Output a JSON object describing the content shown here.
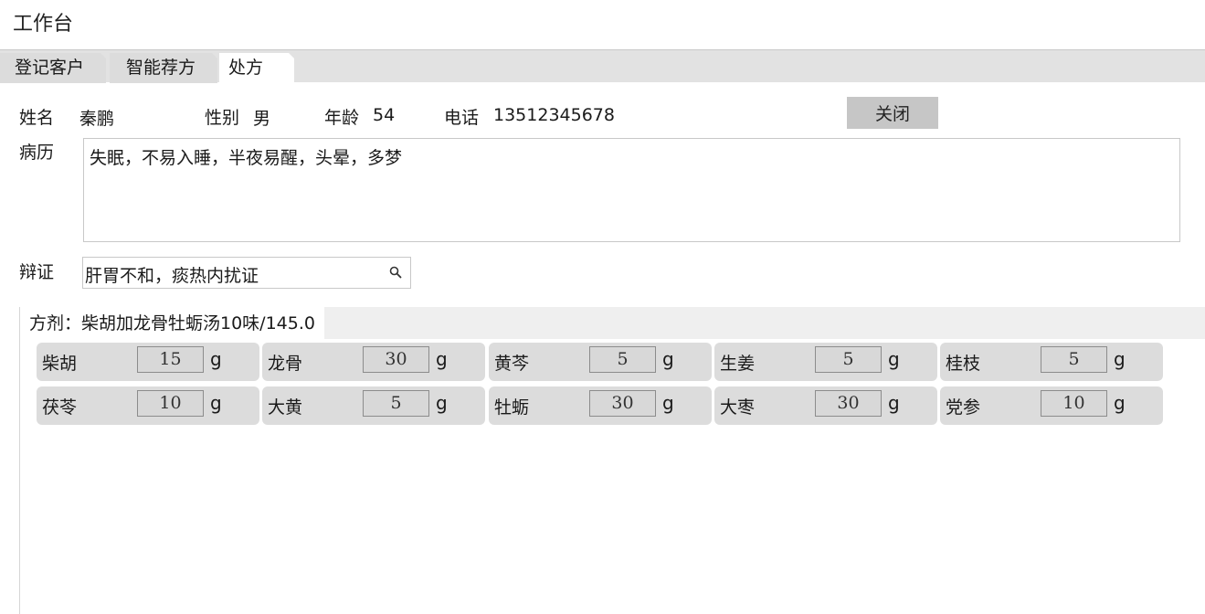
{
  "app": {
    "title": "工作台"
  },
  "tabs": [
    {
      "label": "登记客户",
      "active": false
    },
    {
      "label": "智能荐方",
      "active": false
    },
    {
      "label": "处方",
      "active": true
    }
  ],
  "patient": {
    "name_label": "姓名",
    "name": "秦鹏",
    "gender_label": "性别",
    "gender": "男",
    "age_label": "年龄",
    "age": "54",
    "phone_label": "电话",
    "phone": "13512345678"
  },
  "close_button": "关闭",
  "history": {
    "label": "病历",
    "value": "失眠，不易入睡，半夜易醒，头晕，多梦"
  },
  "diagnosis": {
    "label": "辩证",
    "value": "肝胃不和，痰热内扰证",
    "icon": "search-icon"
  },
  "formula": {
    "title": "方剂：柴胡加龙骨牡蛎汤10味/145.0",
    "unit": "g",
    "herbs": [
      {
        "name": "柴胡",
        "dose": "15"
      },
      {
        "name": "龙骨",
        "dose": "30"
      },
      {
        "name": "黄芩",
        "dose": "5"
      },
      {
        "name": "生姜",
        "dose": "5"
      },
      {
        "name": "桂枝",
        "dose": "5"
      },
      {
        "name": "茯苓",
        "dose": "10"
      },
      {
        "name": "大黄",
        "dose": "5"
      },
      {
        "name": "牡蛎",
        "dose": "30"
      },
      {
        "name": "大枣",
        "dose": "30"
      },
      {
        "name": "党参",
        "dose": "10"
      }
    ]
  }
}
